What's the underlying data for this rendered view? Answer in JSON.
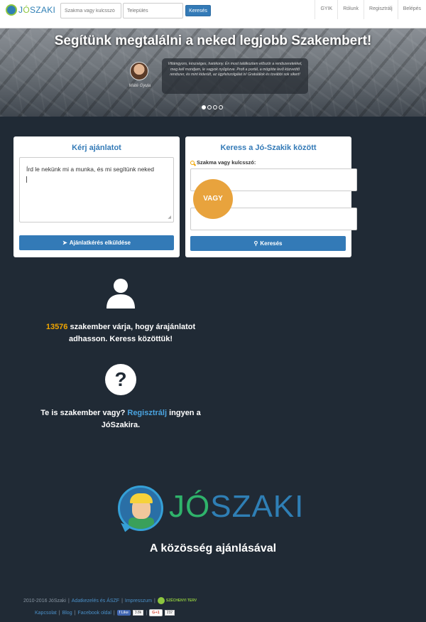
{
  "navbar": {
    "logo_text_prefix": "J",
    "logo_text_accent": "Ó",
    "logo_text_suffix": "SZAKI",
    "search_placeholder": "Szakma vagy kulcsszó",
    "location_placeholder": "Település",
    "search_button": "Keresés",
    "links": [
      "GYIK",
      "Rólunk",
      "Regisztrálj",
      "Belépés"
    ]
  },
  "hero": {
    "title": "Segítünk megtalálni a neked legjobb Szakembert!",
    "testimonial_name": "Máté Gyula",
    "testimonial_text": "Villámgyors, készséges, hatékony. Én most találkoztam először a rendszeretekkel, meg kell mondjam, le vagyok nyűgözve. Profi a portál, a mögötte levő közvetítő rendszer, és mint kiderült, az ügyfelszolgálat is! Gratulálok és további sok sikert!",
    "slides": 4,
    "active_slide": 1
  },
  "request_panel": {
    "title": "Kérj ajánlatot",
    "textarea_text": "Írd le nekünk mi a munka, és mi segítünk neked",
    "submit_button": "Ajánlatkérés elküldése"
  },
  "search_panel": {
    "title": "Keress a Jó-Szakik között",
    "keyword_label": "Szakma vagy kulcsszó:",
    "or_badge": "VAGY",
    "search_button": "Keresés"
  },
  "stats": {
    "count": "13576",
    "count_text": "szakember várja, hogy árajánlatot adhasson. Keress közöttük!"
  },
  "register_prompt": {
    "prefix": "Te is szakember vagy?",
    "link": "Regisztrálj",
    "suffix": "ingyen a JóSzakira."
  },
  "brand": {
    "logo_part1": "JÓ",
    "logo_part2": "SZAKI",
    "tagline": "A közösség ajánlásával"
  },
  "footer": {
    "copyright": "2010-2016 JóSzaki",
    "link_privacy": "Adatkezelés és ÁSZF",
    "link_imprint": "Impresszum",
    "badge_text": "SZÉCHENYI TERV",
    "link_contact": "Kapcsolat",
    "link_blog": "Blog",
    "link_facebook": "Facebook oldal",
    "fb_like_label": "Like",
    "fb_like_count": "3.8k",
    "gplus_label": "G+1",
    "gplus_count": "232"
  },
  "colors": {
    "accent_blue": "#337ab7",
    "accent_orange": "#f0a500",
    "background": "#202a35"
  }
}
